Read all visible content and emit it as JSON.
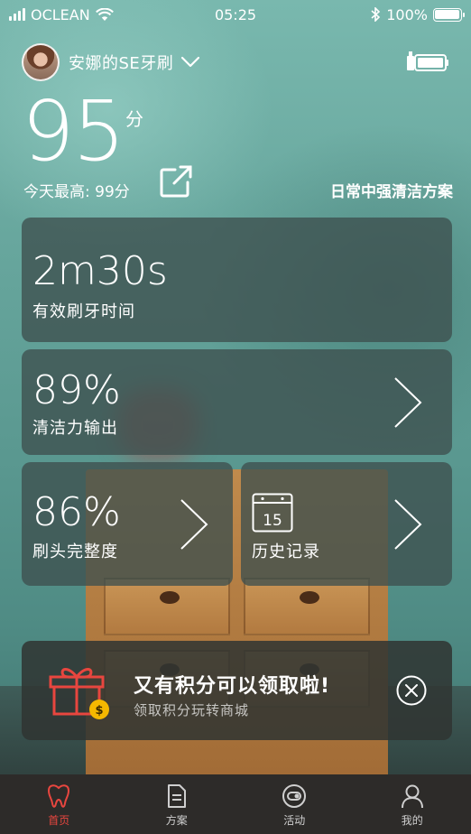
{
  "status_bar": {
    "carrier": "OCLEAN",
    "time": "05:25",
    "battery_percent": "100%"
  },
  "header": {
    "device_name": "安娜的SE牙刷",
    "score": "95",
    "score_unit": "分",
    "today_best": "今天最高: 99分",
    "plan_name": "日常中强清洁方案"
  },
  "cards": {
    "brush_time": {
      "value": "2m30s",
      "label": "有效刷牙时间"
    },
    "clean_power": {
      "value": "89%",
      "label": "清洁力输出"
    },
    "head_integrity": {
      "value": "86%",
      "label": "刷头完整度"
    },
    "history": {
      "label": "历史记录",
      "calendar_day": "15"
    }
  },
  "promo": {
    "title": "又有积分可以领取啦!",
    "subtitle": "领取积分玩转商城",
    "accent_color": "#e8463f"
  },
  "tabs": [
    {
      "label": "首页",
      "icon": "tooth-icon",
      "active": true
    },
    {
      "label": "方案",
      "icon": "document-icon",
      "active": false
    },
    {
      "label": "活动",
      "icon": "activity-icon",
      "active": false
    },
    {
      "label": "我的",
      "icon": "person-icon",
      "active": false
    }
  ]
}
